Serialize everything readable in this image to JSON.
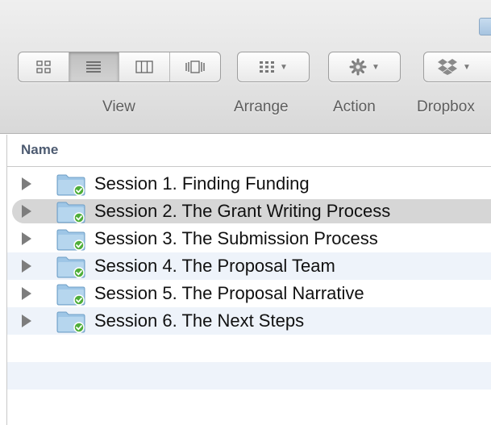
{
  "toolbar": {
    "groups": [
      {
        "id": "view",
        "label": "View",
        "buttons": [
          "icon-view-icon",
          "list-view-icon",
          "column-view-icon",
          "cover-flow-icon"
        ],
        "active_index": 1
      },
      {
        "id": "arrange",
        "label": "Arrange",
        "icon": "arrange-icon"
      },
      {
        "id": "action",
        "label": "Action",
        "icon": "gear-icon"
      },
      {
        "id": "dropbox",
        "label": "Dropbox",
        "icon": "dropbox-icon"
      }
    ]
  },
  "list": {
    "column_header": "Name",
    "selected_index": 1,
    "items": [
      {
        "label": "Session 1. Finding Funding"
      },
      {
        "label": "Session 2. The Grant Writing Process"
      },
      {
        "label": "Session 3. The Submission Process"
      },
      {
        "label": "Session 4. The Proposal Team"
      },
      {
        "label": "Session 5. The Proposal Narrative"
      },
      {
        "label": "Session 6. The Next Steps"
      }
    ]
  },
  "colors": {
    "stripe": "#eef3fa",
    "selection": "#d6d6d6",
    "folder": "#9ec6e6",
    "sync_badge": "#4fae3a",
    "header_text": "#4d5b71"
  }
}
